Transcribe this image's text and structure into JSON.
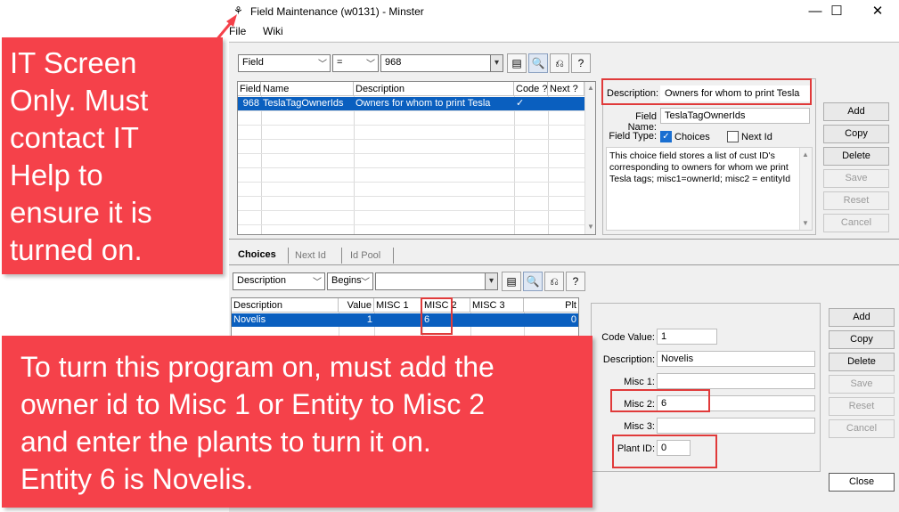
{
  "window": {
    "title": "Field Maintenance (w0131) - Minster",
    "app_icon": "app-icon",
    "controls": [
      "minimize-icon",
      "maximize-icon",
      "close-icon"
    ]
  },
  "menu": [
    "File",
    "Wiki"
  ],
  "top_filter": {
    "field": "Field",
    "operator": "=",
    "value": "968"
  },
  "fields_grid": {
    "columns": [
      "Field",
      "Name",
      "Description",
      "Code ?",
      "Next ?"
    ],
    "rows": [
      {
        "field": "968",
        "name": "TeslaTagOwnerIds",
        "description": "Owners for whom to print Tesla",
        "code": "✓",
        "next": ""
      }
    ]
  },
  "detail": {
    "description_label": "Description:",
    "description_value": "Owners for whom to print Tesla",
    "field_name_label": "Field Name:",
    "field_name_value": "TeslaTagOwnerIds",
    "field_type_label": "Field Type:",
    "choices_label": "Choices",
    "choices_checked": true,
    "nextid_label": "Next Id",
    "nextid_checked": false,
    "notes": "This choice field stores a list of cust ID's corresponding to owners for whom we print Tesla tags; misc1=ownerId; misc2 = entityId"
  },
  "top_buttons": [
    "Add",
    "Copy",
    "Delete",
    "Save",
    "Reset",
    "Cancel"
  ],
  "tabs": [
    "Choices",
    "Next Id",
    "Id Pool"
  ],
  "choice_filter": {
    "field": "Description",
    "operator": "Begins",
    "value": ""
  },
  "choices_grid": {
    "columns": [
      "Description",
      "Value",
      "MISC 1",
      "MISC 2",
      "MISC 3",
      "Plt"
    ],
    "rows": [
      {
        "description": "Novelis",
        "value": "1",
        "misc1": "",
        "misc2": "6",
        "misc3": "",
        "plt": "0"
      }
    ]
  },
  "choice_detail": {
    "code_value_label": "Code Value:",
    "code_value": "1",
    "description_label": "Description:",
    "description": "Novelis",
    "misc1_label": "Misc 1:",
    "misc1": "",
    "misc2_label": "Misc 2:",
    "misc2": "6",
    "misc3_label": "Misc 3:",
    "misc3": "",
    "plant_id_label": "Plant ID:",
    "plant_id": "0"
  },
  "bottom_buttons": [
    "Add",
    "Copy",
    "Delete",
    "Save",
    "Reset",
    "Cancel",
    "Close"
  ],
  "callouts": {
    "it_screen": "IT Screen\nOnly. Must\ncontact IT\nHelp to\nensure it is\nturned on.",
    "instructions": "To turn this program on, must add the\nowner id to Misc 1 or Entity to Misc 2\nand enter the plants to turn it on.\nEntity 6 is Novelis."
  },
  "colors": {
    "callout": "#f5414a",
    "highlight_box": "#e03a3a",
    "selection": "#0a5fbf"
  }
}
